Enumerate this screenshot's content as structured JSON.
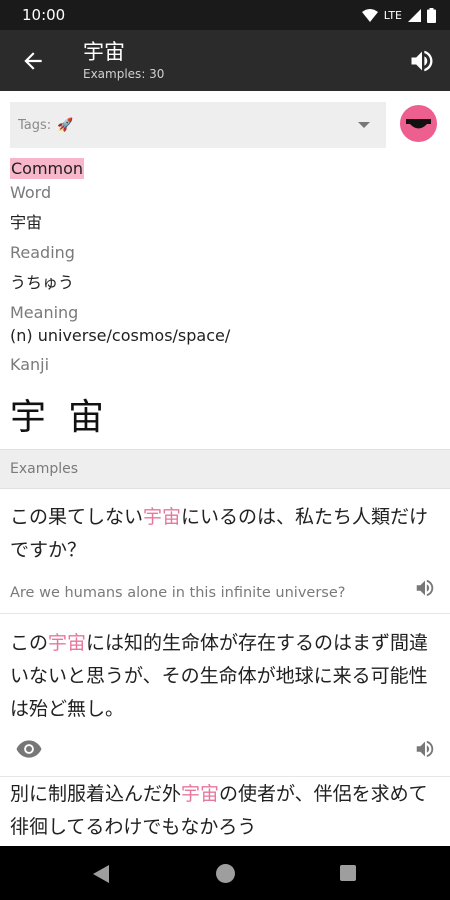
{
  "status": {
    "time": "10:00",
    "network": "LTE"
  },
  "app_bar": {
    "title": "宇宙",
    "subtitle": "Examples: 30"
  },
  "tags": {
    "label": "Tags:",
    "emoji": "🚀"
  },
  "word": {
    "badge": "Common",
    "word_label": "Word",
    "word_value": "宇宙",
    "reading_label": "Reading",
    "reading_value": "うちゅう",
    "meaning_label": "Meaning",
    "meaning_value": "(n) universe/cosmos/space/",
    "kanji_label": "Kanji",
    "kanji_value": "宇宙"
  },
  "examples_header": "Examples",
  "examples": [
    {
      "jp_before": "この果てしない",
      "jp_highlight": "宇宙",
      "jp_after": "にいるのは、私たち人類だけですか？",
      "en": "Are we humans alone in this infinite universe?"
    },
    {
      "jp_before": "この",
      "jp_highlight": "宇宙",
      "jp_after": "には知的生命体が存在するのはまず間違いないと思うが、その生命体が地球に来る可能性は殆ど無し。",
      "en": ""
    },
    {
      "jp_before": "別に制服着込んだ外",
      "jp_highlight": "宇宙",
      "jp_after": "の使者が、伴侶を求めて徘徊してるわけでもなかろう",
      "en": ""
    }
  ],
  "colors": {
    "highlight": "#e7789d",
    "badge": "#f7b6c9",
    "face_button": "#ec5f8f"
  }
}
